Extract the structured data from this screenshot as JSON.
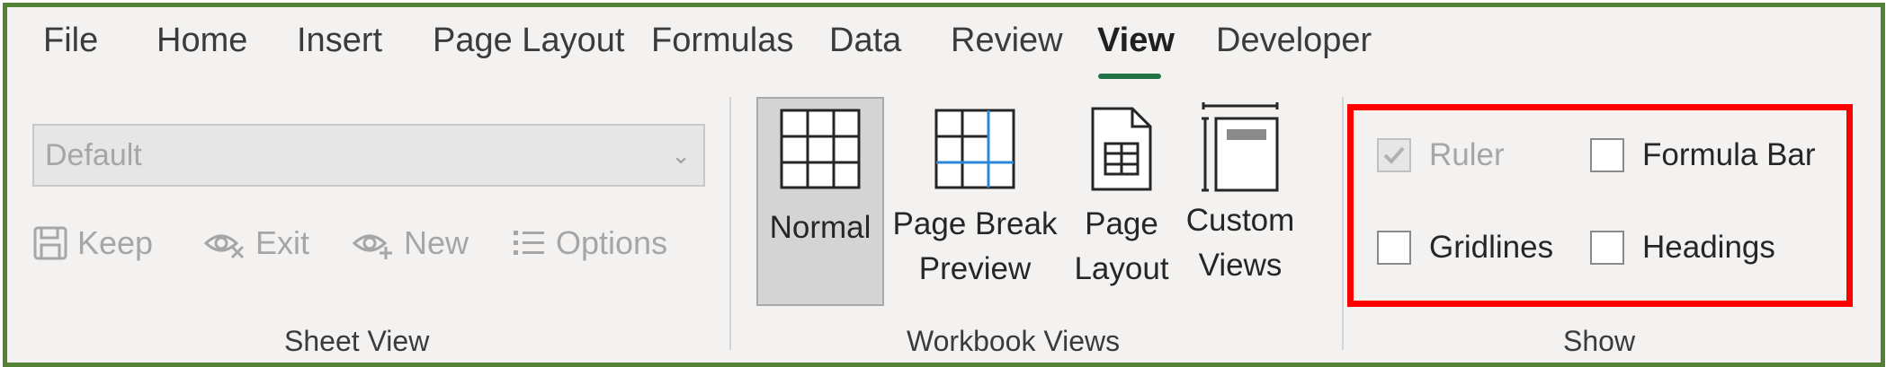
{
  "tabs": [
    {
      "label": "File",
      "active": false
    },
    {
      "label": "Home",
      "active": false
    },
    {
      "label": "Insert",
      "active": false
    },
    {
      "label": "Page Layout",
      "active": false
    },
    {
      "label": "Formulas",
      "active": false
    },
    {
      "label": "Data",
      "active": false
    },
    {
      "label": "Review",
      "active": false
    },
    {
      "label": "View",
      "active": true
    },
    {
      "label": "Developer",
      "active": false
    }
  ],
  "sheet_view": {
    "select_value": "Default",
    "keep_label": "Keep",
    "exit_label": "Exit",
    "new_label": "New",
    "options_label": "Options",
    "group_label": "Sheet View"
  },
  "workbook_views": {
    "normal_label": "Normal",
    "page_break_line1": "Page Break",
    "page_break_line2": "Preview",
    "page_layout_line1": "Page",
    "page_layout_line2": "Layout",
    "custom_views_line1": "Custom",
    "custom_views_line2": "Views",
    "group_label": "Workbook Views"
  },
  "show": {
    "ruler_label": "Ruler",
    "ruler_checked": true,
    "ruler_disabled": true,
    "formula_bar_label": "Formula Bar",
    "formula_bar_checked": false,
    "gridlines_label": "Gridlines",
    "gridlines_checked": false,
    "headings_label": "Headings",
    "headings_checked": false,
    "group_label": "Show"
  },
  "colors": {
    "frame_border": "#538135",
    "active_tab_underline": "#217346",
    "highlight": "#ff0000",
    "ribbon_bg": "#f3f2f1"
  }
}
